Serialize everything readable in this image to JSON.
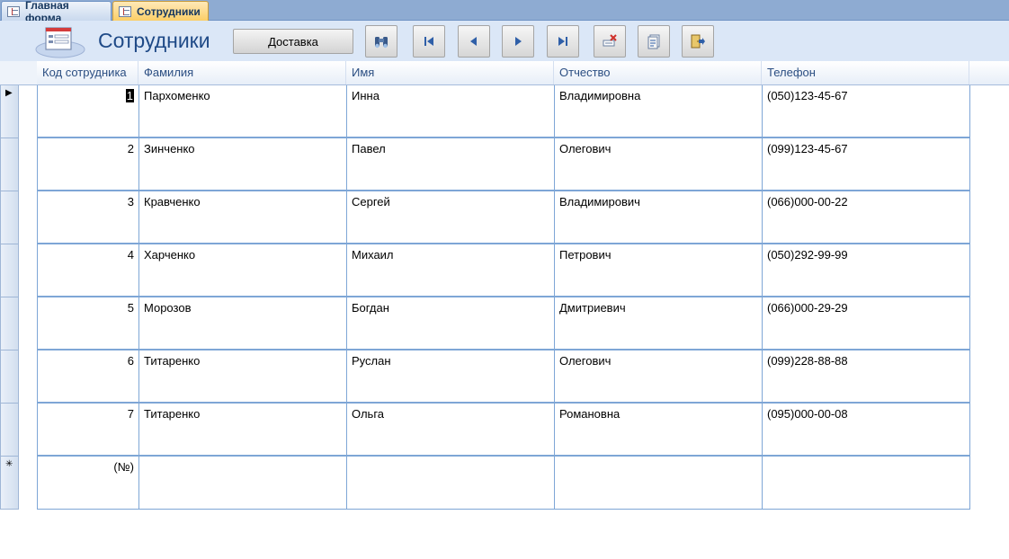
{
  "tabs": [
    {
      "label": "Главная форма",
      "active": false
    },
    {
      "label": "Сотрудники",
      "active": true
    }
  ],
  "form": {
    "title": "Сотрудники",
    "delivery_button_label": "Доставка",
    "nav_buttons": [
      {
        "name": "find-button",
        "icon": "binoculars-icon"
      },
      {
        "name": "first-record-button",
        "icon": "first-record-icon"
      },
      {
        "name": "previous-record-button",
        "icon": "previous-record-icon"
      },
      {
        "name": "next-record-button",
        "icon": "next-record-icon"
      },
      {
        "name": "last-record-button",
        "icon": "last-record-icon"
      },
      {
        "name": "delete-record-button",
        "icon": "delete-record-icon"
      },
      {
        "name": "copy-record-button",
        "icon": "copy-record-icon"
      },
      {
        "name": "close-form-button",
        "icon": "exit-door-icon"
      }
    ]
  },
  "datasheet": {
    "columns": [
      "Код сотрудника",
      "Фамилия",
      "Имя",
      "Отчество",
      "Телефон"
    ],
    "rows": [
      [
        "1",
        "Пархоменко",
        "Инна",
        "Владимировна",
        "(050)123-45-67"
      ],
      [
        "2",
        "Зинченко",
        "Павел",
        "Олегович",
        "(099)123-45-67"
      ],
      [
        "3",
        "Кравченко",
        "Сергей",
        "Владимирович",
        "(066)000-00-22"
      ],
      [
        "4",
        "Харченко",
        "Михаил",
        "Петрович",
        "(050)292-99-99"
      ],
      [
        "5",
        "Морозов",
        "Богдан",
        "Дмитриевич",
        "(066)000-29-29"
      ],
      [
        "6",
        "Титаренко",
        "Руслан",
        "Олегович",
        "(099)228-88-88"
      ],
      [
        "7",
        "Титаренко",
        "Ольга",
        "Романовна",
        "(095)000-00-08"
      ]
    ],
    "new_row_placeholder": "(№)",
    "current_row_marker": "▶",
    "new_row_marker": "✳"
  },
  "colors": {
    "accent": "#1f4a87",
    "grid_line": "#7ea6d6",
    "header_bg": "#dbe7f7",
    "active_tab": "#fbcd63"
  }
}
